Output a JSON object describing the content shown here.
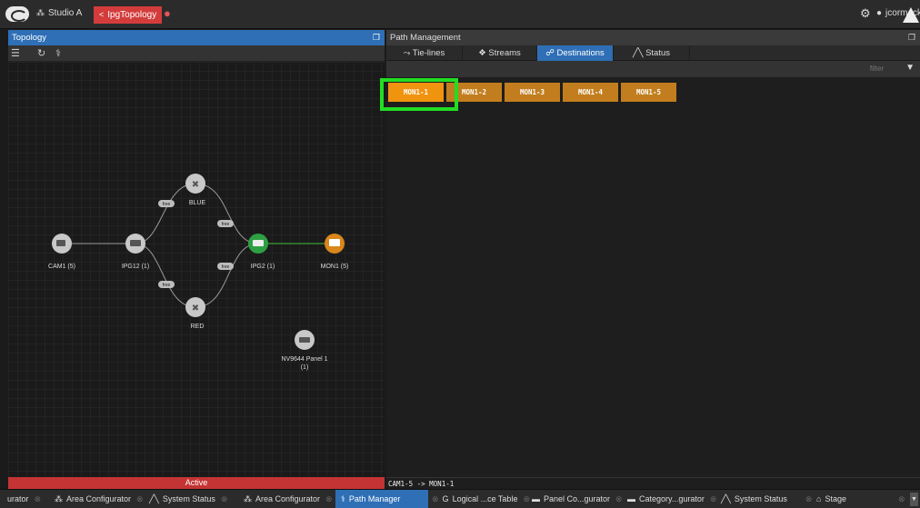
{
  "topbar": {
    "studio_label": "Studio A",
    "active_tab": "IpgTopology",
    "user": "jcormack"
  },
  "topology": {
    "title": "Topology",
    "status": "Active",
    "nodes": {
      "cam1": "CAM1 (5)",
      "ipg12": "IPG12 (1)",
      "blue": "BLUE",
      "red": "RED",
      "ipg2": "IPG2 (1)",
      "mon1": "MON1 (5)",
      "panel_line1": "NV9644 Panel 1",
      "panel_line2": "(1)"
    },
    "link_label": "free"
  },
  "path_management": {
    "title": "Path Management",
    "tabs": [
      "Tie-lines",
      "Streams",
      "Destinations",
      "Status"
    ],
    "active_tab": "Destinations",
    "filter_placeholder": "filter",
    "destinations": [
      "MON1-1",
      "MON1-2",
      "MON1-3",
      "MON1-4",
      "MON1-5"
    ],
    "selected_destination": "MON1-1",
    "route_status": "CAM1-5 -> MON1-1"
  },
  "taskbar": {
    "items": [
      "urator",
      "Area Configurator",
      "System Status",
      "Area Configurator",
      "Path Manager",
      "Logical ...ce Table",
      "Panel Co...gurator",
      "Category...gurator",
      "System Status",
      "Stage"
    ],
    "active_item": "Path Manager"
  },
  "colors": {
    "accent_blue": "#2e6fb6",
    "alert_red": "#d43c3c",
    "destination_orange": "#c27e1e",
    "selected_orange": "#f0930f",
    "highlight_green": "#22dd22",
    "node_green": "#2ea043",
    "node_orange": "#d9861a"
  }
}
